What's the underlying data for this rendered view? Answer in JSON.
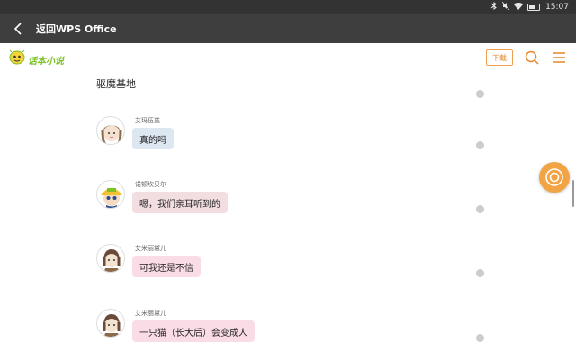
{
  "status_bar": {
    "time": "15:07",
    "icons": [
      "bluetooth-icon",
      "mute-icon",
      "wifi-icon",
      "battery-icon"
    ]
  },
  "title_bar": {
    "back_icon": "chevron-left-icon",
    "title": "返回WPS Office"
  },
  "app_header": {
    "logo_text": "话本小说",
    "download_label": "下载",
    "search_icon": "search-icon",
    "menu_icon": "menu-icon"
  },
  "story": {
    "previous_text": "驱魔基地",
    "messages": [
      {
        "speaker": "艾玛伍兹",
        "text": "真的吗",
        "avatar": "avatar-girl",
        "bubble_color": "#dde7f2"
      },
      {
        "speaker": "诺顿坎贝尔",
        "text": "嗯，我们亲耳听到的",
        "avatar": "avatar-boy-yellow-hat",
        "bubble_color": "#f2dde0"
      },
      {
        "speaker": "艾米丽黛儿",
        "text": "可我还是不信",
        "avatar": "avatar-girl-brown",
        "bubble_color": "#fadce6"
      },
      {
        "speaker": "艾米丽黛儿",
        "text": "一只猫（长大后）会变成人",
        "avatar": "avatar-girl-brown",
        "bubble_color": "#fadce6"
      }
    ]
  },
  "floating_button": {
    "icon": "fab-circle-icon",
    "color": "#f2a445"
  },
  "colors": {
    "accent": "#e8862a",
    "title_bar": "#3e3e3e",
    "status_bar": "#333333"
  }
}
